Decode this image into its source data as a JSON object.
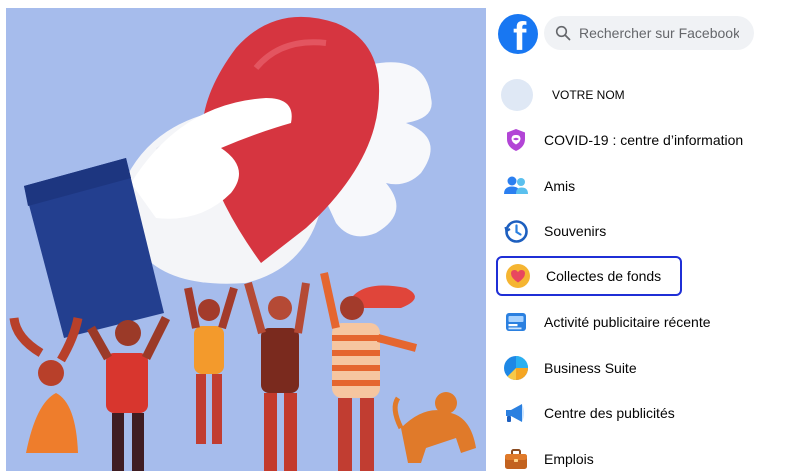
{
  "colors": {
    "facebook_blue": "#1877f2",
    "highlight_border": "#1f2fd6",
    "illustration_bg": "#a6bcec",
    "heart_red": "#d63540"
  },
  "header": {
    "logo_icon": "facebook-logo-icon",
    "logo_glyph": "f",
    "search_placeholder": "Rechercher sur Facebook"
  },
  "profile": {
    "name": "VOTRE NOM"
  },
  "menu": {
    "items": [
      {
        "label": "COVID-19 : centre d’information",
        "icon": "covid-shield-icon"
      },
      {
        "label": "Amis",
        "icon": "friends-icon"
      },
      {
        "label": "Souvenirs",
        "icon": "memories-clock-icon"
      },
      {
        "label": "Collectes de fonds",
        "icon": "fundraiser-heart-icon",
        "highlighted": true
      },
      {
        "label": "Activité publicitaire récente",
        "icon": "ad-activity-icon"
      },
      {
        "label": "Business Suite",
        "icon": "business-suite-icon"
      },
      {
        "label": "Centre des publicités",
        "icon": "megaphone-icon"
      },
      {
        "label": "Emplois",
        "icon": "briefcase-icon"
      }
    ]
  }
}
